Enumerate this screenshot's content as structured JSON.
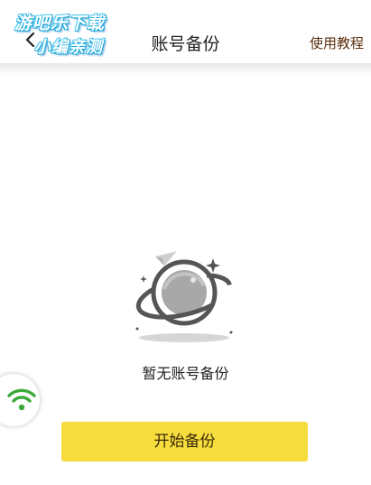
{
  "header": {
    "title": "账号备份",
    "help_link": "使用教程",
    "back_icon": "chevron-left-icon"
  },
  "watermark": {
    "line1": "游吧乐下载",
    "line2": "小编亲测"
  },
  "empty_state": {
    "icon": "planet-icon",
    "message": "暂无账号备份"
  },
  "floating_button": {
    "icon": "wifi-icon",
    "color": "#3aaa3a"
  },
  "actions": {
    "start_backup_label": "开始备份",
    "start_backup_color": "#f6dc3c"
  }
}
